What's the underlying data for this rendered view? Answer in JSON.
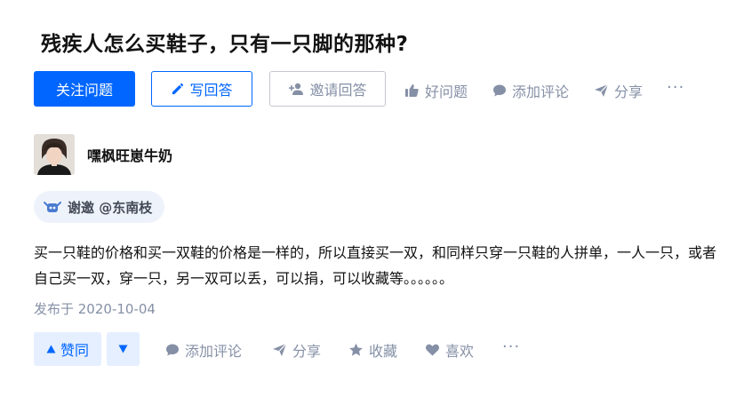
{
  "question": {
    "title": "残疾人怎么买鞋子，只有一只脚的那种?"
  },
  "question_actions": {
    "follow_label": "关注问题",
    "write_label": "写回答",
    "invite_label": "邀请回答",
    "good_question_label": "好问题",
    "comment_label": "添加评论",
    "share_label": "分享",
    "more_label": "···"
  },
  "answer": {
    "author": "嘿枫旺崽牛奶",
    "thanks_label": "谢邀 @东南枝",
    "content": "买一只鞋的价格和买一双鞋的价格是一样的，所以直接买一双，和同样只穿一只鞋的人拼单，一人一只，或者自己买一双，穿一只，另一双可以丢，可以捐，可以收藏等。。。。。。",
    "published": "发布于 2020-10-04"
  },
  "answer_actions": {
    "upvote_label": "赞同",
    "comment_label": "添加评论",
    "share_label": "分享",
    "collect_label": "收藏",
    "like_label": "喜欢",
    "more_label": "···"
  },
  "colors": {
    "brand": "#0066ff",
    "muted": "#8590a6",
    "upvote_bg": "#e5efff",
    "thanks_bg": "#eef3fb"
  },
  "icons": [
    "pencil-icon",
    "add-user-icon",
    "thumb-up-icon",
    "comment-icon",
    "paper-plane-icon",
    "more-icon",
    "robot-icon",
    "triangle-up-icon",
    "triangle-down-icon",
    "star-icon",
    "heart-icon"
  ]
}
